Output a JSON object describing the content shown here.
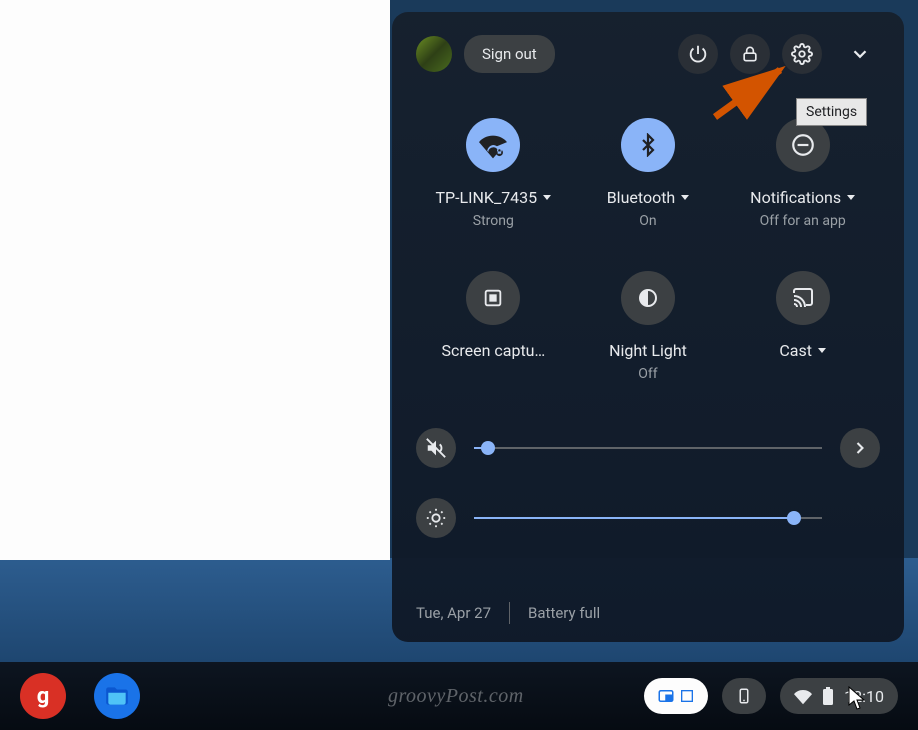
{
  "header": {
    "signout": "Sign out"
  },
  "tooltip": "Settings",
  "tiles": [
    {
      "id": "wifi",
      "label": "TP-LINK_7435",
      "sub": "Strong",
      "state": "on",
      "dropdown": true
    },
    {
      "id": "bluetooth",
      "label": "Bluetooth",
      "sub": "On",
      "state": "on",
      "dropdown": true
    },
    {
      "id": "notifications",
      "label": "Notifications",
      "sub": "Off for an app",
      "state": "off",
      "dropdown": true
    },
    {
      "id": "screencapture",
      "label": "Screen captu…",
      "sub": "",
      "state": "off",
      "dropdown": false
    },
    {
      "id": "nightlight",
      "label": "Night Light",
      "sub": "Off",
      "state": "off",
      "dropdown": false
    },
    {
      "id": "cast",
      "label": "Cast",
      "sub": "",
      "state": "off",
      "dropdown": true
    }
  ],
  "sliders": {
    "volume": {
      "percent": 4
    },
    "brightness": {
      "percent": 92
    }
  },
  "footer": {
    "date": "Tue, Apr 27",
    "battery": "Battery full"
  },
  "shelf": {
    "watermark": "groovyPost.com",
    "time": "12:10"
  }
}
